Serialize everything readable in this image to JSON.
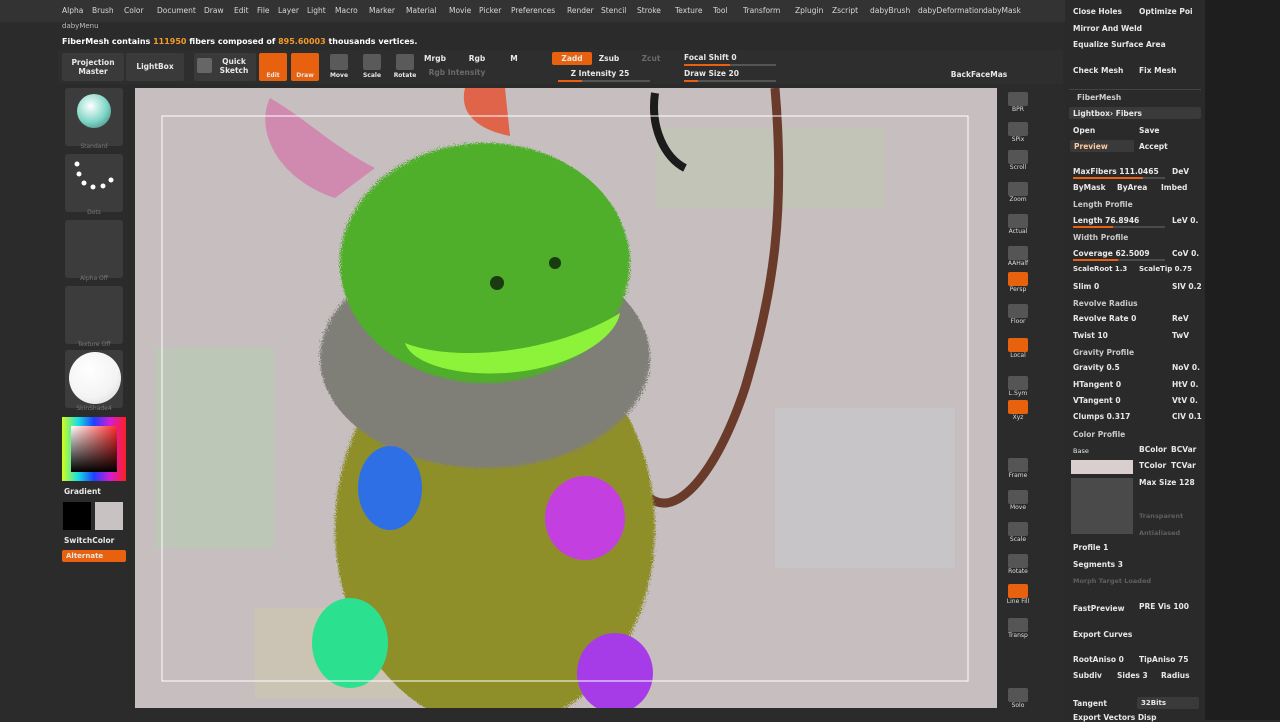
{
  "menu": [
    "Alpha",
    "Brush",
    "Color",
    "Document",
    "Draw",
    "Edit",
    "File",
    "Layer",
    "Light",
    "Macro",
    "Marker",
    "Material",
    "Movie",
    "Picker",
    "Preferences",
    "Render",
    "Stencil",
    "Stroke",
    "Texture",
    "Tool",
    "Transform",
    "Zplugin",
    "Zscript",
    "dabyBrush",
    "dabyDeformation",
    "dabyMask"
  ],
  "menu2": "dabyMenu",
  "status": {
    "prefix": "FiberMesh contains ",
    "fibers": "111950",
    "middle": " fibers composed of ",
    "vertices": "895.60003",
    "suffix": " thousands vertices."
  },
  "toolbar": {
    "projection_master": "Projection Master",
    "lightbox": "LightBox",
    "quick_sketch": "Quick Sketch",
    "edit": "Edit",
    "draw": "Draw",
    "move": "Move",
    "scale": "Scale",
    "rotate": "Rotate",
    "mrgb": "Mrgb",
    "rgb": "Rgb",
    "m": "M",
    "rgb_intensity": "Rgb Intensity",
    "zadd": "Zadd",
    "zsub": "Zsub",
    "zcut": "Zcut",
    "z_intensity": "Z Intensity 25",
    "focal_shift": "Focal Shift 0",
    "draw_size": "Draw Size 20",
    "backfacemask": "BackFaceMas"
  },
  "left_shelf": {
    "brush": "Standard",
    "stroke": "Dots",
    "alpha": "Alpha Off",
    "texture": "Texture Off",
    "material": "SkinShade4",
    "gradient": "Gradient",
    "switchcolor": "SwitchColor",
    "alternate": "Alternate"
  },
  "right_shelf": [
    "BPR",
    "SPix",
    "Scroll",
    "Zoom",
    "Actual",
    "AAHalf",
    "Persp",
    "Floor",
    "Local",
    "L.Sym",
    "Xyz",
    "Frame",
    "Move",
    "Scale",
    "Rotate",
    "Line Fill",
    "Transp",
    "Solo"
  ],
  "palette": {
    "close_holes": "Close Holes",
    "optimize": "Optimize Poi",
    "mirror_weld": "Mirror And Weld",
    "equalize": "Equalize Surface Area",
    "check_mesh": "Check Mesh",
    "fix_mesh": "Fix Mesh",
    "fibermesh": "FiberMesh",
    "lightbox_fibers": "Lightbox› Fibers",
    "open": "Open",
    "save": "Save",
    "preview": "Preview",
    "accept": "Accept",
    "maxfibers": "MaxFibers 111.0465",
    "dev": "DeV",
    "bymask": "ByMask",
    "byarea": "ByArea",
    "imbed": "Imbed",
    "length_profile": "Length Profile",
    "length": "Length 76.8946",
    "lev": "LeV 0.",
    "width_profile": "Width Profile",
    "coverage": "Coverage 62.5009",
    "cov": "CoV 0.",
    "scaleroot": "ScaleRoot 1.3",
    "scaletip": "ScaleTip 0.75",
    "slim": "Slim 0",
    "slv": "SlV 0.2",
    "revolve_radius": "Revolve Radius",
    "revolve_rate": "Revolve Rate 0",
    "rev": "ReV",
    "twist": "Twist 10",
    "twv": "TwV",
    "gravity_profile": "Gravity Profile",
    "gravity": "Gravity 0.5",
    "nov": "NoV 0.",
    "htangent": "HTangent 0",
    "htv": "HtV 0.",
    "vtangent": "VTangent 0",
    "vtv": "VtV 0.",
    "clumps": "Clumps 0.317",
    "clv": "ClV 0.1",
    "color_profile": "Color Profile",
    "base": "Base",
    "bcolor": "BColor",
    "bcvar": "BCVar",
    "tcolor": "TColor",
    "tcvar": "TCVar",
    "max_size": "Max Size 128",
    "transparent": "Transparent",
    "antialiased": "Antialiased",
    "profile": "Profile 1",
    "segments": "Segments 3",
    "morph": "Morph Target Loaded",
    "fastpreview": "FastPreview",
    "previs": "PRE Vis 100",
    "export_curves": "Export Curves",
    "rootaniso": "RootAniso 0",
    "tipaniso": "TipAniso 75",
    "subdiv": "Subdiv",
    "sides": "Sides 3",
    "radius": "Radius",
    "tangent": "Tangent",
    "bits": "32Bits",
    "export_vectors": "Export Vectors Disp"
  },
  "colors": {
    "accent": "#e8610e",
    "canvas_bg": "#c7bfbf",
    "body_green": "#4fae2c",
    "fur": "#8f8f2a",
    "blue_hand": "#2f6fe6",
    "magenta_hand": "#c43fe0",
    "teal_foot": "#2be08f",
    "tail": "#6a3a2a"
  }
}
